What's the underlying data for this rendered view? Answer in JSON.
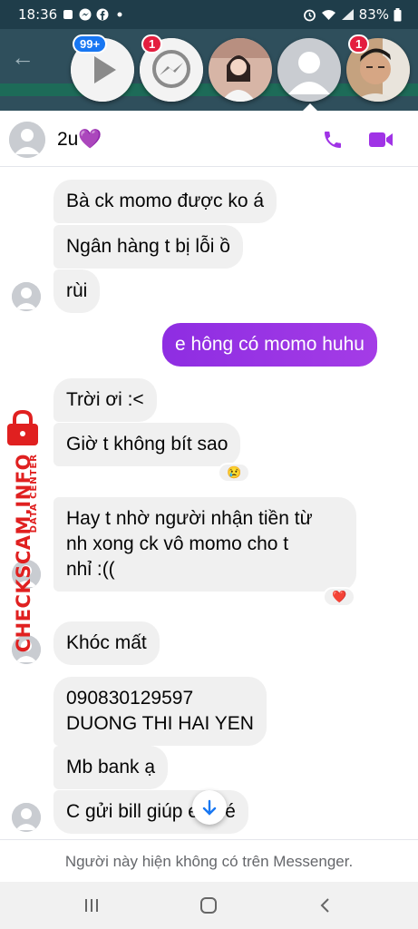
{
  "status_bar": {
    "time": "18:36",
    "battery": "83%",
    "notification_icons": [
      "flag-icon",
      "messenger-icon",
      "facebook-icon",
      "dot-icon"
    ]
  },
  "chat_heads": [
    {
      "name": "media-player-head",
      "badge": "99+",
      "badge_color": "#1877f2"
    },
    {
      "name": "messenger-head",
      "badge": "1",
      "badge_color": "#e41e3f"
    },
    {
      "name": "contact-head-girl",
      "badge": ""
    },
    {
      "name": "contact-head-placeholder",
      "badge": ""
    },
    {
      "name": "contact-head-man",
      "badge": "1",
      "badge_color": "#e41e3f"
    }
  ],
  "header": {
    "contact_name": "2u💜"
  },
  "messages": [
    {
      "text": "Bà ck momo được ko á",
      "dir": "in"
    },
    {
      "text": "Ngân hàng t bị lỗi ồ",
      "dir": "in"
    },
    {
      "text": "rùi",
      "dir": "in"
    },
    {
      "text": "e hông có momo huhu",
      "dir": "out"
    },
    {
      "text": "Trời ơi :<",
      "dir": "in"
    },
    {
      "text": "Giờ t không bít sao",
      "dir": "in",
      "reaction": "😢"
    },
    {
      "text": "Hay t nhờ người nhận tiền từ\nnh xong ck vô momo cho t\nnhỉ :((",
      "dir": "in",
      "reaction": "❤️"
    },
    {
      "text": "Khóc mất",
      "dir": "in"
    },
    {
      "text": "090830129597\nDUONG THI HAI YEN",
      "dir": "in"
    },
    {
      "text": "Mb bank ạ",
      "dir": "in"
    },
    {
      "text": "C gửi bill giúp e nhé",
      "dir": "in"
    }
  ],
  "watermark": {
    "main": "CHECKSCAM.INFO",
    "sub": "DATA CENTER"
  },
  "footer": {
    "note": "Người này hiện không có trên Messenger."
  },
  "colors": {
    "accent": "#a033e6",
    "outgoing_bubble": "#8e2de2",
    "incoming_bubble": "#f0f0f0",
    "watermark": "#e02020"
  }
}
